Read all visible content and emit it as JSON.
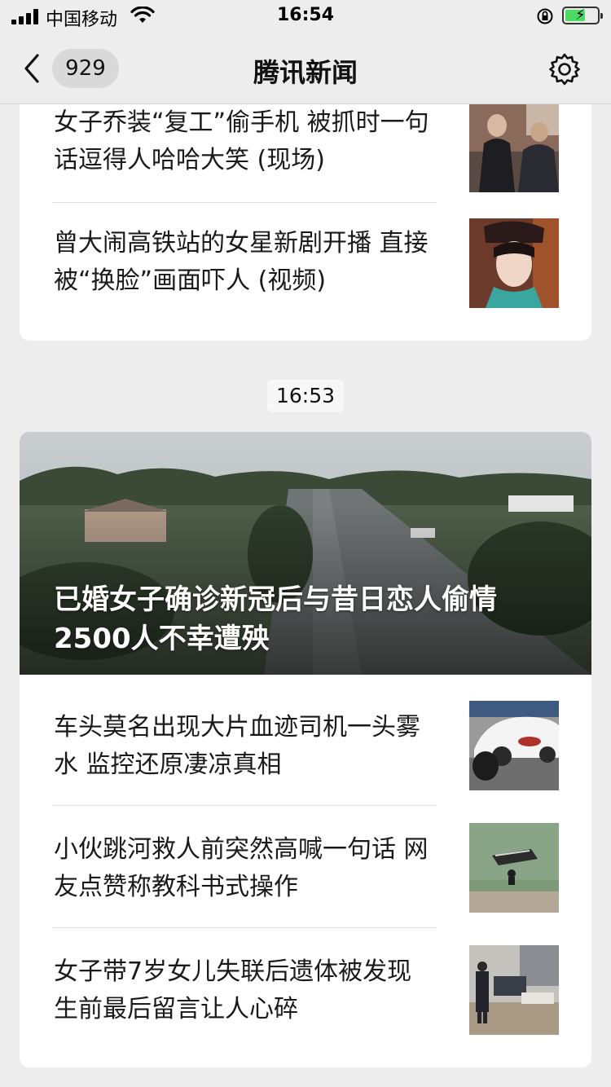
{
  "status_bar": {
    "carrier": "中国移动",
    "time": "16:54"
  },
  "nav": {
    "unread_count": "929",
    "title": "腾讯新闻"
  },
  "top_card": {
    "items": [
      {
        "title": "女子乔装“复工”偷手机 被抓时一句话逗得人哈哈大笑 (现场)"
      },
      {
        "title": "曾大闹高铁站的女星新剧开播 直接被“换脸”画面吓人 (视频)"
      }
    ]
  },
  "timestamp": "16:53",
  "bottom_card": {
    "hero_title": "已婚女子确诊新冠后与昔日恋人偷情 2500人不幸遭殃",
    "items": [
      {
        "title": "车头莫名出现大片血迹司机一头雾水 监控还原凄凉真相"
      },
      {
        "title": "小伙跳河救人前突然高喊一句话 网友点赞称教科书式操作"
      },
      {
        "title": "女子带7岁女儿失联后遗体被发现 生前最后留言让人心碎"
      }
    ]
  },
  "icons": {
    "back": "chevron-left-icon",
    "settings": "gear-icon",
    "wifi": "wifi-icon",
    "signal": "cellular-signal-icon",
    "orientation_lock": "orientation-lock-icon",
    "battery": "battery-charging-icon"
  },
  "colors": {
    "background": "#ededed",
    "card": "#ffffff",
    "battery_fill": "#4cd964"
  }
}
